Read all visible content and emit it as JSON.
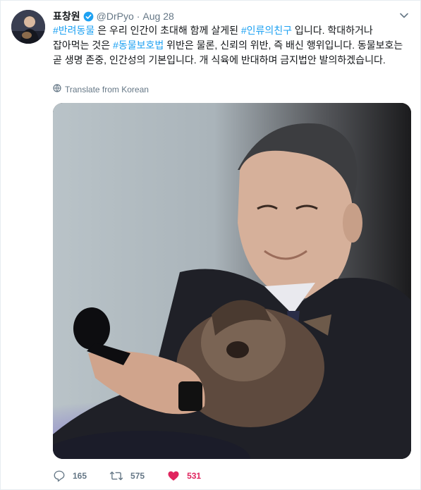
{
  "tweet": {
    "author_name": "표창원",
    "handle": "@DrPyo",
    "separator": "·",
    "date": "Aug 28",
    "text_parts": {
      "p0": "#반려동물",
      "p1": " 은 우리 인간이 초대해 함께 살게된 ",
      "p2": "#인류의친구",
      "p3": " 입니다. 학대하거나 잡아먹는 것은 ",
      "p4": "#동물보호법",
      "p5": " 위반은 물론, 신뢰의 위반, 즉 배신 행위입니다. 동물보호는 곧 생명 존중, 인간성의 기본입니다. 개 식육에 반대하며 금지법안 발의하겠습니다."
    },
    "translate_label": "Translate from Korean",
    "icons": {
      "verified": "verified-badge-icon",
      "caret": "chevron-down-icon",
      "globe": "globe-icon",
      "reply": "reply-icon",
      "retweet": "retweet-icon",
      "like": "heart-icon"
    },
    "colors": {
      "link": "#1da1f2",
      "like": "#e0245e",
      "muted": "#657786"
    }
  },
  "actions": {
    "reply_count": "165",
    "retweet_count": "575",
    "like_count": "531"
  }
}
